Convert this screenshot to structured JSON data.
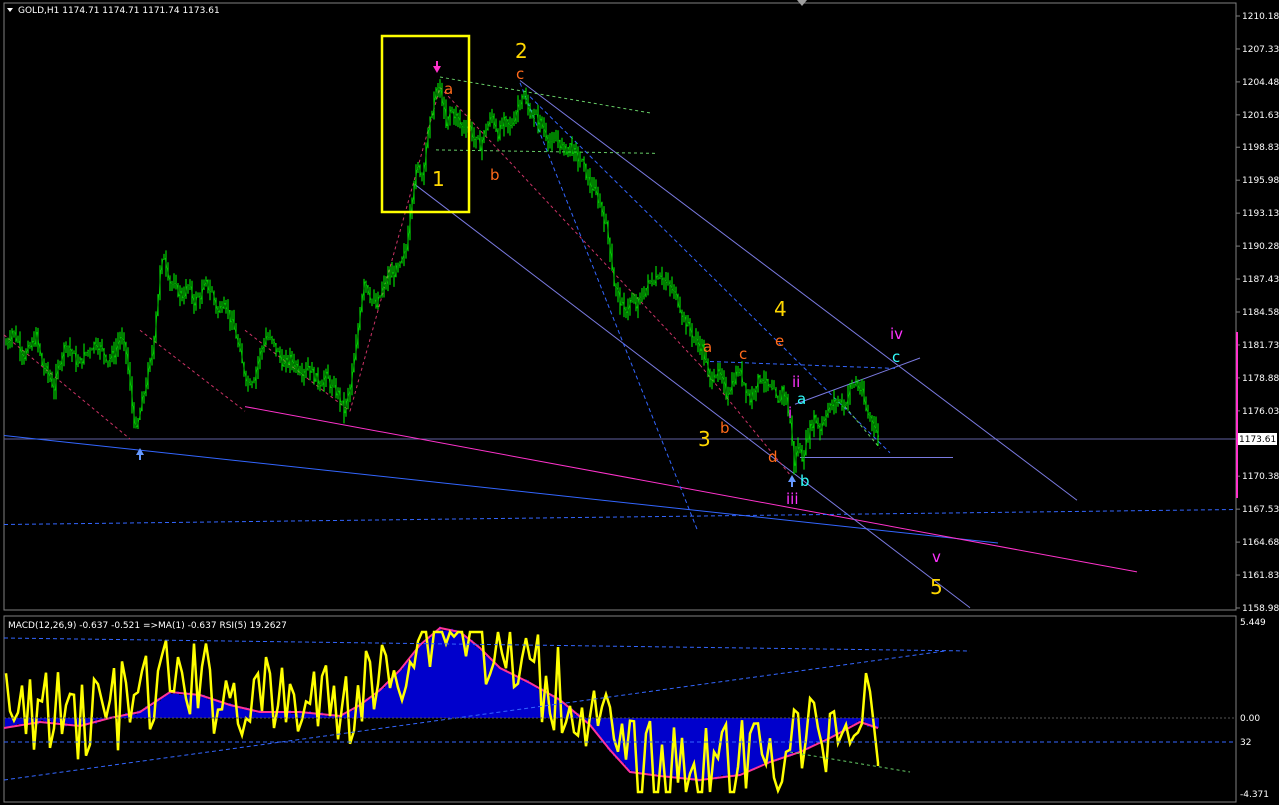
{
  "main_panel": {
    "header": "GOLD,H1  1174.71 1174.71 1171.74 1173.61",
    "symbol": "GOLD,H1",
    "ohlc": {
      "open": 1174.71,
      "high": 1174.71,
      "low": 1171.74,
      "close": 1173.61
    },
    "price_axis_labels": [
      "1210.18",
      "1207.33",
      "1204.48",
      "1201.63",
      "1198.83",
      "1195.98",
      "1193.13",
      "1190.28",
      "1187.43",
      "1184.58",
      "1181.73",
      "1178.88",
      "1176.03",
      "1173.61",
      "1170.38",
      "1167.53",
      "1164.68",
      "1161.83",
      "1158.98"
    ],
    "current_price_label": "1173.61",
    "current_price": 1173.61,
    "colors": {
      "background": "#000000",
      "candle_up": "#00ff00",
      "candle_down": "#00cc00",
      "grid": "#808080",
      "current_price_line": "#6060a0",
      "trendline_blue": "#3366ff",
      "trendline_violet": "#7a7ae0",
      "trendline_magenta": "#ff33cc",
      "highlight_box": "#ffff00"
    }
  },
  "wave_labels": {
    "yellow": [
      "1",
      "2",
      "3",
      "4",
      "5"
    ],
    "orange": [
      "a",
      "b",
      "c",
      "a",
      "b",
      "c",
      "d",
      "e"
    ],
    "magenta": [
      "i",
      "ii",
      "iii",
      "iv",
      "v"
    ],
    "cyan": [
      "a",
      "b",
      "c"
    ]
  },
  "arrows": {
    "up_left": "up-arrow-icon",
    "down_top": "down-arrow-icon",
    "up_bottom": "up-arrow-icon"
  },
  "indicator_panel": {
    "header": "MACD(12,26,9) -0.637 -0.521  =>MA(1) -0.637  RSI(5) 19.2627",
    "axis_labels": [
      "5.449",
      "0.00",
      "32",
      "-4.371"
    ],
    "colors": {
      "histogram": "#0000ff",
      "signal": "#ff3399",
      "rsi": "#ffff00"
    }
  },
  "chart_data": {
    "type": "candlestick",
    "title": "GOLD,H1",
    "ylim": [
      1158.98,
      1210.18
    ],
    "close_path": [
      [
        0,
        1182.4
      ],
      [
        6,
        1181.8
      ],
      [
        12,
        1183.0
      ],
      [
        18,
        1182.0
      ],
      [
        24,
        1180.8
      ],
      [
        30,
        1181.5
      ],
      [
        36,
        1182.5
      ],
      [
        42,
        1180.0
      ],
      [
        48,
        1179.2
      ],
      [
        54,
        1178.0
      ],
      [
        60,
        1180.5
      ],
      [
        66,
        1182.0
      ],
      [
        72,
        1181.0
      ],
      [
        78,
        1180.0
      ],
      [
        84,
        1180.8
      ],
      [
        90,
        1181.5
      ],
      [
        96,
        1182.0
      ],
      [
        102,
        1181.2
      ],
      [
        108,
        1180.5
      ],
      [
        114,
        1181.0
      ],
      [
        120,
        1182.5
      ],
      [
        126,
        1181.0
      ],
      [
        132,
        1176.5
      ],
      [
        136,
        1174.2
      ],
      [
        140,
        1176.0
      ],
      [
        146,
        1178.5
      ],
      [
        152,
        1181.0
      ],
      [
        156,
        1184.5
      ],
      [
        160,
        1188.0
      ],
      [
        164,
        1189.5
      ],
      [
        170,
        1187.2
      ],
      [
        176,
        1186.5
      ],
      [
        182,
        1186.0
      ],
      [
        188,
        1186.8
      ],
      [
        194,
        1185.5
      ],
      [
        200,
        1186.0
      ],
      [
        206,
        1187.0
      ],
      [
        212,
        1186.2
      ],
      [
        218,
        1184.5
      ],
      [
        224,
        1185.8
      ],
      [
        230,
        1184.0
      ],
      [
        236,
        1182.5
      ],
      [
        242,
        1180.0
      ],
      [
        248,
        1178.5
      ],
      [
        254,
        1179.0
      ],
      [
        260,
        1181.0
      ],
      [
        266,
        1182.5
      ],
      [
        272,
        1182.0
      ],
      [
        278,
        1181.0
      ],
      [
        284,
        1180.0
      ],
      [
        290,
        1180.5
      ],
      [
        296,
        1180.0
      ],
      [
        302,
        1179.5
      ],
      [
        308,
        1180.0
      ],
      [
        314,
        1179.0
      ],
      [
        320,
        1178.5
      ],
      [
        326,
        1179.0
      ],
      [
        332,
        1178.0
      ],
      [
        338,
        1177.5
      ],
      [
        344,
        1176.0
      ],
      [
        350,
        1178.0
      ],
      [
        356,
        1181.5
      ],
      [
        360,
        1185.0
      ],
      [
        364,
        1187.5
      ],
      [
        370,
        1186.0
      ],
      [
        376,
        1185.0
      ],
      [
        382,
        1186.5
      ],
      [
        388,
        1187.5
      ],
      [
        394,
        1188.0
      ],
      [
        400,
        1188.5
      ],
      [
        406,
        1190.0
      ],
      [
        410,
        1193.5
      ],
      [
        414,
        1196.0
      ],
      [
        418,
        1197.0
      ],
      [
        422,
        1196.5
      ],
      [
        426,
        1199.0
      ],
      [
        430,
        1201.0
      ],
      [
        434,
        1203.0
      ],
      [
        438,
        1204.0
      ],
      [
        442,
        1203.0
      ],
      [
        446,
        1200.5
      ],
      [
        450,
        1202.0
      ],
      [
        456,
        1201.5
      ],
      [
        462,
        1200.5
      ],
      [
        468,
        1201.0
      ],
      [
        474,
        1199.5
      ],
      [
        480,
        1199.0
      ],
      [
        486,
        1200.5
      ],
      [
        492,
        1201.5
      ],
      [
        498,
        1200.0
      ],
      [
        504,
        1201.0
      ],
      [
        510,
        1200.5
      ],
      [
        516,
        1202.0
      ],
      [
        522,
        1203.5
      ],
      [
        528,
        1202.0
      ],
      [
        534,
        1201.5
      ],
      [
        540,
        1201.0
      ],
      [
        546,
        1200.0
      ],
      [
        552,
        1199.0
      ],
      [
        558,
        1199.5
      ],
      [
        564,
        1198.5
      ],
      [
        570,
        1199.0
      ],
      [
        576,
        1198.0
      ],
      [
        582,
        1197.5
      ],
      [
        588,
        1196.0
      ],
      [
        594,
        1195.0
      ],
      [
        600,
        1194.0
      ],
      [
        606,
        1192.0
      ],
      [
        610,
        1190.0
      ],
      [
        614,
        1187.0
      ],
      [
        618,
        1186.0
      ],
      [
        624,
        1184.5
      ],
      [
        630,
        1185.5
      ],
      [
        636,
        1185.0
      ],
      [
        642,
        1186.0
      ],
      [
        648,
        1187.0
      ],
      [
        654,
        1187.5
      ],
      [
        660,
        1188.0
      ],
      [
        666,
        1187.0
      ],
      [
        672,
        1186.5
      ],
      [
        678,
        1185.5
      ],
      [
        684,
        1184.0
      ],
      [
        690,
        1183.0
      ],
      [
        696,
        1182.0
      ],
      [
        702,
        1181.5
      ],
      [
        706,
        1180.0
      ],
      [
        710,
        1178.5
      ],
      [
        714,
        1179.5
      ],
      [
        720,
        1179.0
      ],
      [
        726,
        1177.5
      ],
      [
        732,
        1178.5
      ],
      [
        738,
        1179.5
      ],
      [
        744,
        1178.5
      ],
      [
        750,
        1177.0
      ],
      [
        756,
        1178.5
      ],
      [
        762,
        1179.0
      ],
      [
        768,
        1178.0
      ],
      [
        774,
        1177.5
      ],
      [
        778,
        1176.5
      ],
      [
        782,
        1178.0
      ],
      [
        786,
        1177.0
      ],
      [
        790,
        1175.0
      ],
      [
        794,
        1171.5
      ],
      [
        798,
        1173.0
      ],
      [
        802,
        1172.0
      ],
      [
        808,
        1174.0
      ],
      [
        814,
        1175.5
      ],
      [
        820,
        1174.5
      ],
      [
        826,
        1176.0
      ],
      [
        832,
        1176.5
      ],
      [
        838,
        1177.0
      ],
      [
        844,
        1176.5
      ],
      [
        850,
        1178.0
      ],
      [
        856,
        1178.5
      ],
      [
        862,
        1177.5
      ],
      [
        866,
        1176.0
      ],
      [
        870,
        1175.5
      ],
      [
        874,
        1175.0
      ],
      [
        878,
        1173.6
      ]
    ],
    "wave_points": [
      {
        "label": "1",
        "price": 1196.8
      },
      {
        "label": "2",
        "price": 1204.5
      },
      {
        "label": "3",
        "price": 1174.9
      },
      {
        "label": "4",
        "price": 1179.9
      },
      {
        "label": "5",
        "price": 1161.8
      }
    ],
    "indicators": {
      "macd": {
        "params": "12,26,9",
        "main": -0.637,
        "signal": -0.521
      },
      "ma": {
        "period": 1,
        "value": -0.637
      },
      "rsi": {
        "period": 5,
        "value": 19.2627
      }
    }
  }
}
